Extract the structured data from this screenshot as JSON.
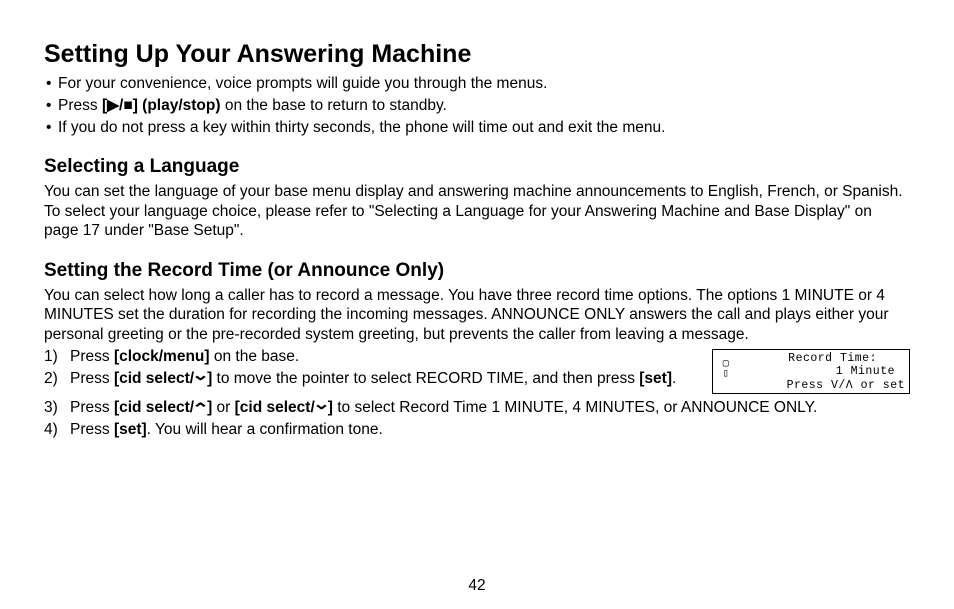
{
  "title": "Setting Up Your Answering Machine",
  "intro": [
    {
      "pre": "For your convenience, voice prompts will guide you through the menus."
    },
    {
      "pre": "Press ",
      "bold": "[▶/■] (play/stop)",
      "post": " on the base to return to standby."
    },
    {
      "pre": "If you do not press a key within thirty seconds, the phone will time out and exit the menu."
    }
  ],
  "sec1": {
    "heading": "Selecting a Language",
    "body": "You can set the language of your base menu display and answering machine announcements to English, French, or Spanish. To select your language choice, please refer to \"Selecting a Language for your Answering Machine and Base Display\" on page 17 under \"Base Setup\"."
  },
  "sec2": {
    "heading": "Setting the Record Time (or Announce Only)",
    "body": "You can select how long a caller has to record a message. You have three record time options. The options 1 MINUTE or 4 MINUTES set the duration for recording the incoming messages. ANNOUNCE ONLY answers the call and plays either your personal greeting or the pre-recorded system greeting, but prevents the caller from leaving a message.",
    "steps": {
      "s1": {
        "num": "1)",
        "a": "Press ",
        "b": "[clock/menu]",
        "c": " on the base."
      },
      "s2": {
        "num": "2)",
        "a": "Press ",
        "b": "[cid select/",
        "c": "]",
        "d": " to move the pointer to select RECORD TIME, and then press ",
        "e": "[set]",
        "f": "."
      },
      "s3": {
        "num": "3)",
        "a": "Press ",
        "b": "[cid select/",
        "c": "]",
        "d": " or ",
        "e": "[cid select/",
        "f": "]",
        "g": " to select Record Time 1 MINUTE, 4 MINUTES, or ANNOUNCE ONLY."
      },
      "s4": {
        "num": "4)",
        "a": "Press ",
        "b": "[set]",
        "c": ". You will hear a confirmation tone."
      }
    }
  },
  "lcd": {
    "line1": "Record Time:",
    "line2": "1 Minute",
    "line3": "Press V/Λ or set"
  },
  "pageNumber": "42"
}
